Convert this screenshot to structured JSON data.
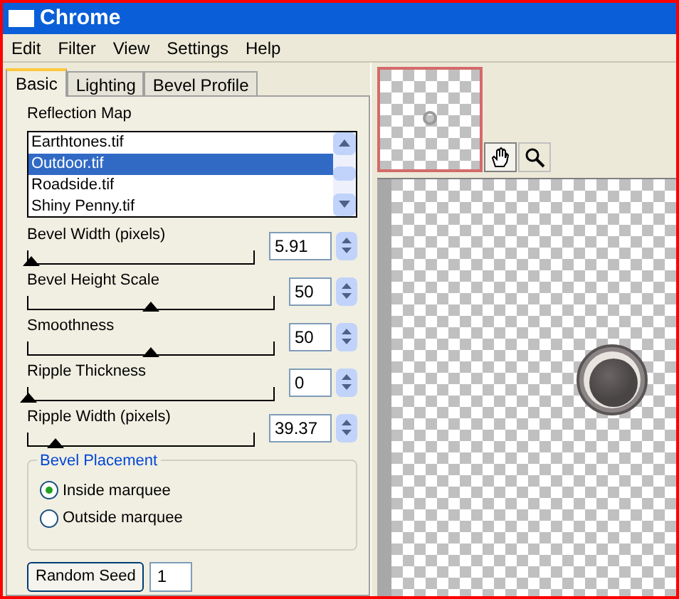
{
  "window": {
    "title": "Chrome"
  },
  "menu": [
    "Edit",
    "Filter",
    "View",
    "Settings",
    "Help"
  ],
  "tabs": [
    {
      "label": "Basic",
      "selected": true
    },
    {
      "label": "Lighting",
      "selected": false
    },
    {
      "label": "Bevel Profile",
      "selected": false
    }
  ],
  "reflection_map": {
    "label": "Reflection Map",
    "items": [
      {
        "label": "Earthtones.tif",
        "selected": false
      },
      {
        "label": "Outdoor.tif",
        "selected": true
      },
      {
        "label": "Roadside.tif",
        "selected": false
      },
      {
        "label": "Shiny Penny.tif",
        "selected": false
      }
    ]
  },
  "sliders": [
    {
      "label": "Bevel Width (pixels)",
      "value": "5.91",
      "level": 0.01,
      "wide": true
    },
    {
      "label": "Bevel Height Scale",
      "value": "50",
      "level": 0.5,
      "wide": false
    },
    {
      "label": "Smoothness",
      "value": "50",
      "level": 0.5,
      "wide": false
    },
    {
      "label": "Ripple Thickness",
      "value": "0",
      "level": 0,
      "wide": false
    },
    {
      "label": "Ripple Width (pixels)",
      "value": "39.37",
      "level": 0.12,
      "wide": true
    }
  ],
  "bevel_placement": {
    "title": "Bevel Placement",
    "options": [
      {
        "label": "Inside marquee",
        "selected": true
      },
      {
        "label": "Outside marquee",
        "selected": false
      }
    ]
  },
  "random_seed": {
    "button": "Random Seed",
    "value": "1"
  }
}
